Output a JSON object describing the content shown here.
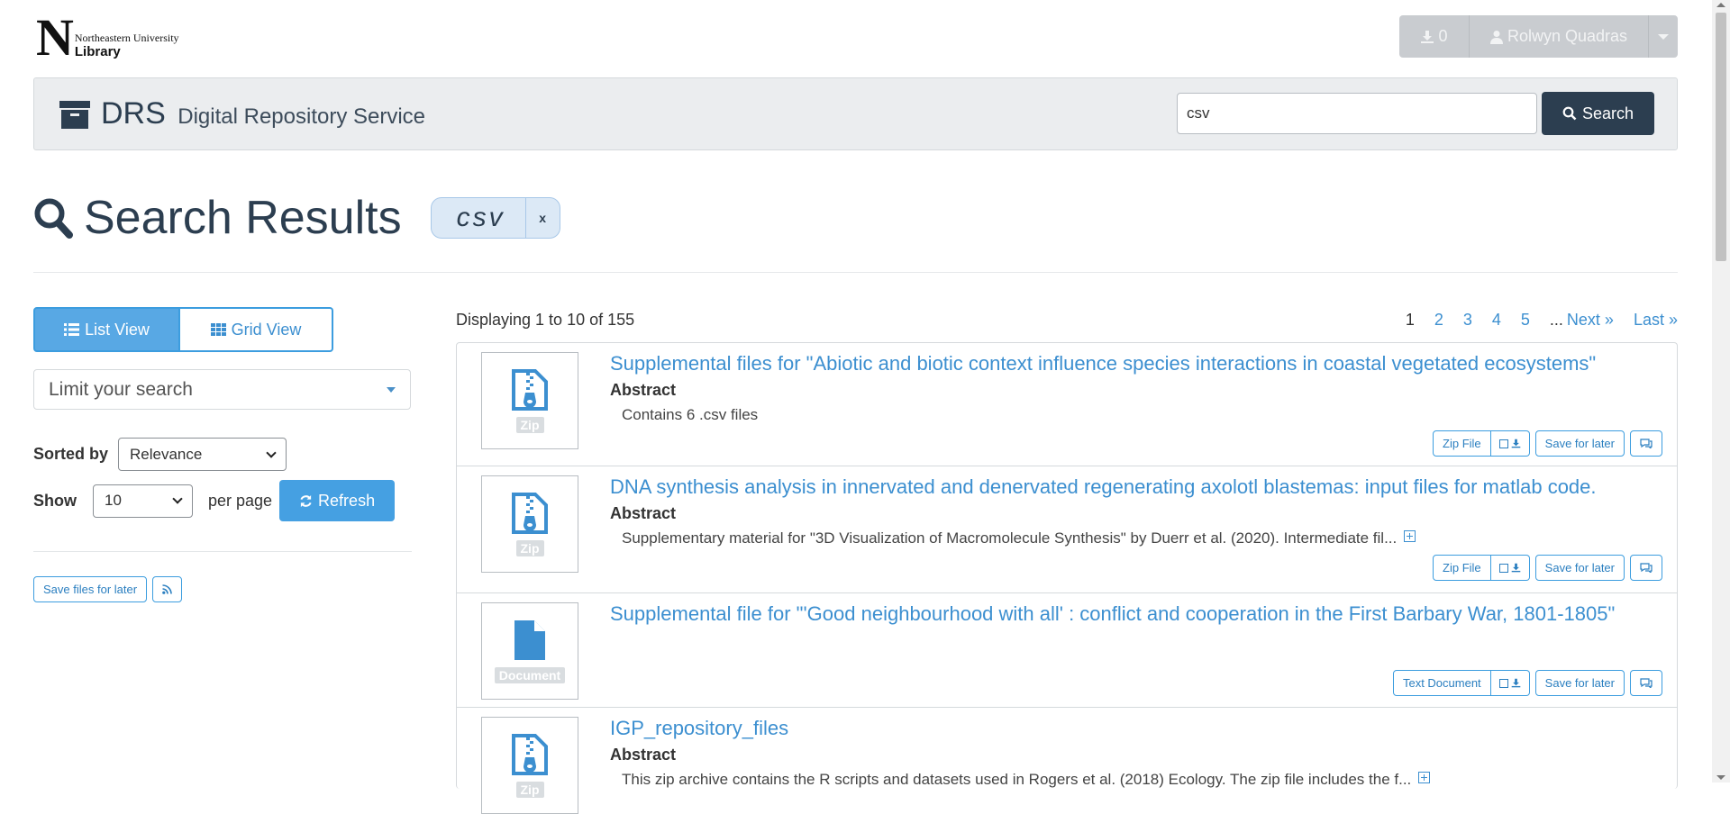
{
  "logo": {
    "letter": "N",
    "university": "Northeastern University",
    "library": "Library"
  },
  "user_controls": {
    "download_count": "0",
    "user_name": "Rolwyn Quadras"
  },
  "header": {
    "title": "DRS",
    "subtitle": "Digital Repository Service"
  },
  "search": {
    "value": "csv",
    "button_label": "Search"
  },
  "results_heading": {
    "title": "Search Results",
    "query": "csv",
    "clear": "x"
  },
  "sidebar": {
    "list_view": "List View",
    "grid_view": "Grid View",
    "limit_search": "Limit your search",
    "sorted_by_label": "Sorted by",
    "sorted_by_value": "Relevance",
    "show_label": "Show",
    "show_value": "10",
    "per_page": "per page",
    "refresh": "Refresh",
    "save_files": "Save files for later"
  },
  "display_count": "Displaying 1 to 10 of 155",
  "pagination": {
    "pages": [
      "1",
      "2",
      "3",
      "4",
      "5"
    ],
    "current": "1",
    "ellipsis": "...",
    "next": "Next »",
    "last": "Last »"
  },
  "results": [
    {
      "title": "Supplemental files for \"Abiotic and biotic context influence species interactions in coastal vegetated ecosystems\"",
      "type_tag": "Zip",
      "abstract_label": "Abstract",
      "abstract": "Contains 6 .csv files",
      "file_type": "Zip File",
      "save_label": "Save for later"
    },
    {
      "title": "DNA synthesis analysis in innervated and denervated regenerating axolotl blastemas: input files for matlab code.",
      "type_tag": "Zip",
      "abstract_label": "Abstract",
      "abstract": "Supplementary material for \"3D Visualization of Macromolecule Synthesis\" by Duerr et al. (2020). Intermediate fil...",
      "file_type": "Zip File",
      "save_label": "Save for later"
    },
    {
      "title": "Supplemental file for \"'Good neighbourhood with all' : conflict and cooperation in the First Barbary War, 1801-1805\"",
      "type_tag": "Document",
      "file_type": "Text Document",
      "save_label": "Save for later"
    },
    {
      "title": "IGP_repository_files",
      "type_tag": "Zip",
      "abstract_label": "Abstract",
      "abstract": "This zip archive contains the R scripts and datasets used in Rogers et al. (2018) Ecology. The zip file includes the f..."
    }
  ],
  "colors": {
    "accent": "#3c8fd0",
    "navy": "#2c3e50",
    "header_bg": "#ebedef"
  }
}
